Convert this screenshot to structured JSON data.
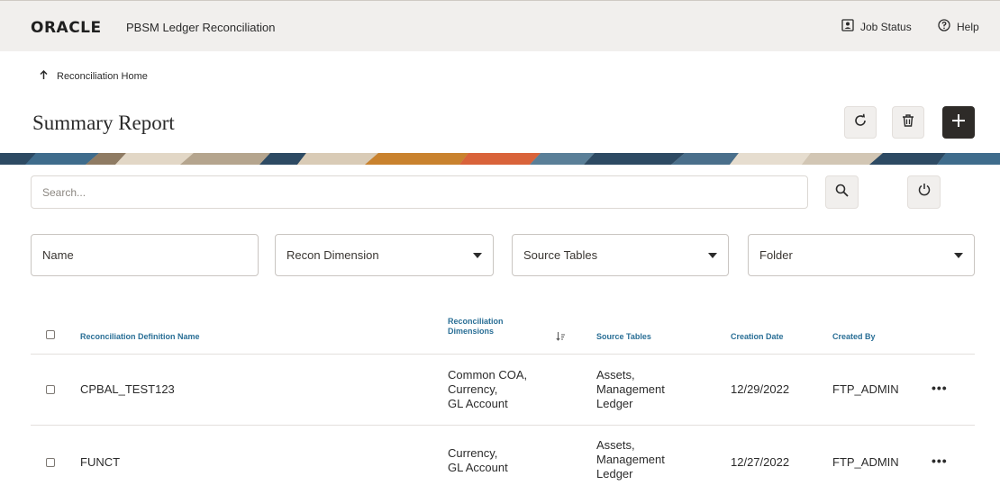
{
  "header": {
    "logo": "ORACLE",
    "app_title": "PBSM Ledger Reconciliation",
    "job_status": "Job Status",
    "help": "Help"
  },
  "breadcrumb": "Reconciliation Home",
  "page_title": "Summary Report",
  "search": {
    "placeholder": "Search..."
  },
  "filters": {
    "name": "Name",
    "recon_dimension": "Recon Dimension",
    "source_tables": "Source Tables",
    "folder": "Folder"
  },
  "table": {
    "columns": {
      "name": "Reconciliation Definition Name",
      "dims_line1": "Reconciliation",
      "dims_line2": "Dimensions",
      "source": "Source Tables",
      "date": "Creation Date",
      "created_by": "Created By"
    },
    "rows": [
      {
        "name": "CPBAL_TEST123",
        "dims": [
          "Common COA,",
          "Currency,",
          "GL Account"
        ],
        "source": [
          "Assets,",
          "Management",
          "Ledger"
        ],
        "date": "12/29/2022",
        "created_by": "FTP_ADMIN",
        "actions": "•••"
      },
      {
        "name": "FUNCT",
        "dims": [
          "Currency,",
          "GL Account"
        ],
        "source": [
          "Assets,",
          "Management",
          "Ledger"
        ],
        "date": "12/27/2022",
        "created_by": "FTP_ADMIN",
        "actions": "•••"
      }
    ]
  },
  "icons": {
    "job_status": "job-status-icon",
    "help": "help-icon",
    "breadcrumb": "arrow-up-icon",
    "refresh": "refresh-icon",
    "delete": "delete-icon",
    "add": "plus-icon",
    "search": "search-icon",
    "reset": "reset-icon",
    "sort": "sort-icon",
    "more": "more-icon"
  },
  "colors": {
    "header_bg": "#f1efed",
    "link_blue": "#2a6f96",
    "add_button": "#2e2b28"
  }
}
